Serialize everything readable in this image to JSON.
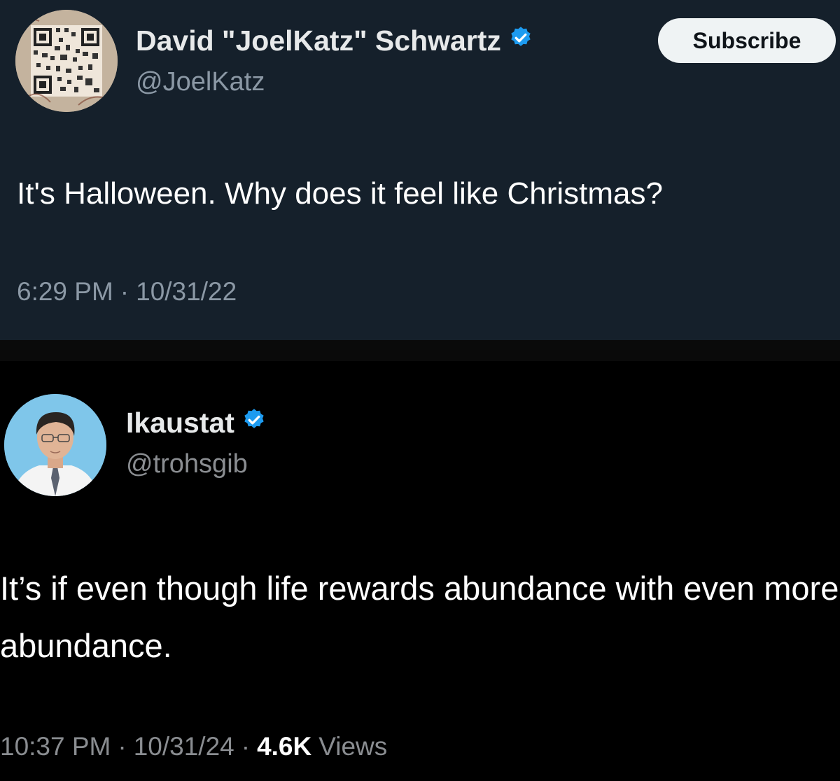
{
  "tweets": [
    {
      "display_name": "David \"JoelKatz\" Schwartz",
      "handle": "@JoelKatz",
      "text": "It's Halloween. Why does it feel like Christmas?",
      "time": "6:29 PM",
      "date": "10/31/22",
      "subscribe_label": "Subscribe",
      "avatar_icon": "qr-code-avatar"
    },
    {
      "display_name": "Ikaustat",
      "handle": "@trohsgib",
      "text": "It’s if even though life rewards abundance with even more abundance.",
      "time": "10:37 PM",
      "date": "10/31/24",
      "views_count": "4.6K",
      "views_label": "Views",
      "avatar_icon": "person-photo-avatar"
    }
  ],
  "separator": "·",
  "colors": {
    "top_background": "#15202b",
    "bottom_background": "#000000",
    "verified_blue": "#1d9bf0",
    "secondary_text": "#8b98a5",
    "subscribe_bg": "#eff3f4"
  }
}
